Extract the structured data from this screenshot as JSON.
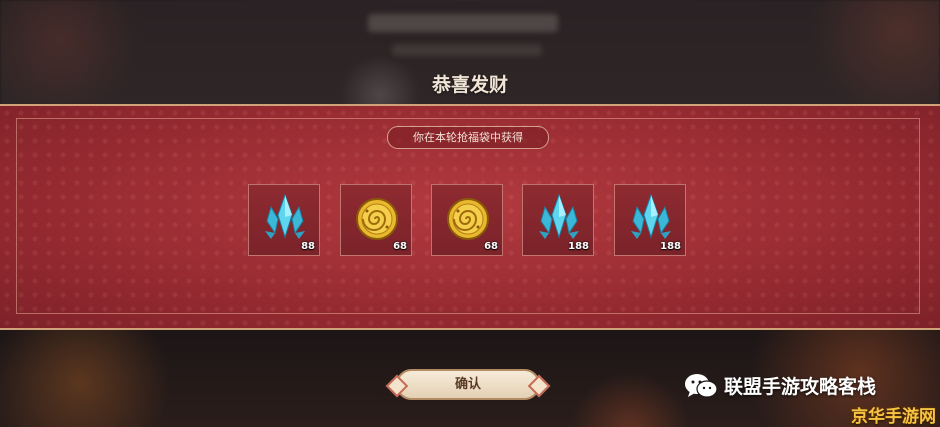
{
  "dialog": {
    "title": "恭喜发财",
    "subtitle": "你在本轮抢福袋中获得",
    "confirm_label": "确认"
  },
  "rewards": [
    {
      "icon": "crystal-icon",
      "quantity": "88"
    },
    {
      "icon": "gold-coin-icon",
      "quantity": "68"
    },
    {
      "icon": "gold-coin-icon",
      "quantity": "68"
    },
    {
      "icon": "crystal-icon",
      "quantity": "188"
    },
    {
      "icon": "crystal-icon",
      "quantity": "188"
    }
  ],
  "watermark": {
    "icon": "wechat-icon",
    "line1": "联盟手游攻略客栈",
    "line2": "京华手游网"
  },
  "colors": {
    "banner_red": "#9a2c33",
    "border_gold": "#cfa27a",
    "crystal_blue": "#46c8e6",
    "coin_gold": "#d9a825",
    "watermark_yellow": "#f6c443"
  }
}
